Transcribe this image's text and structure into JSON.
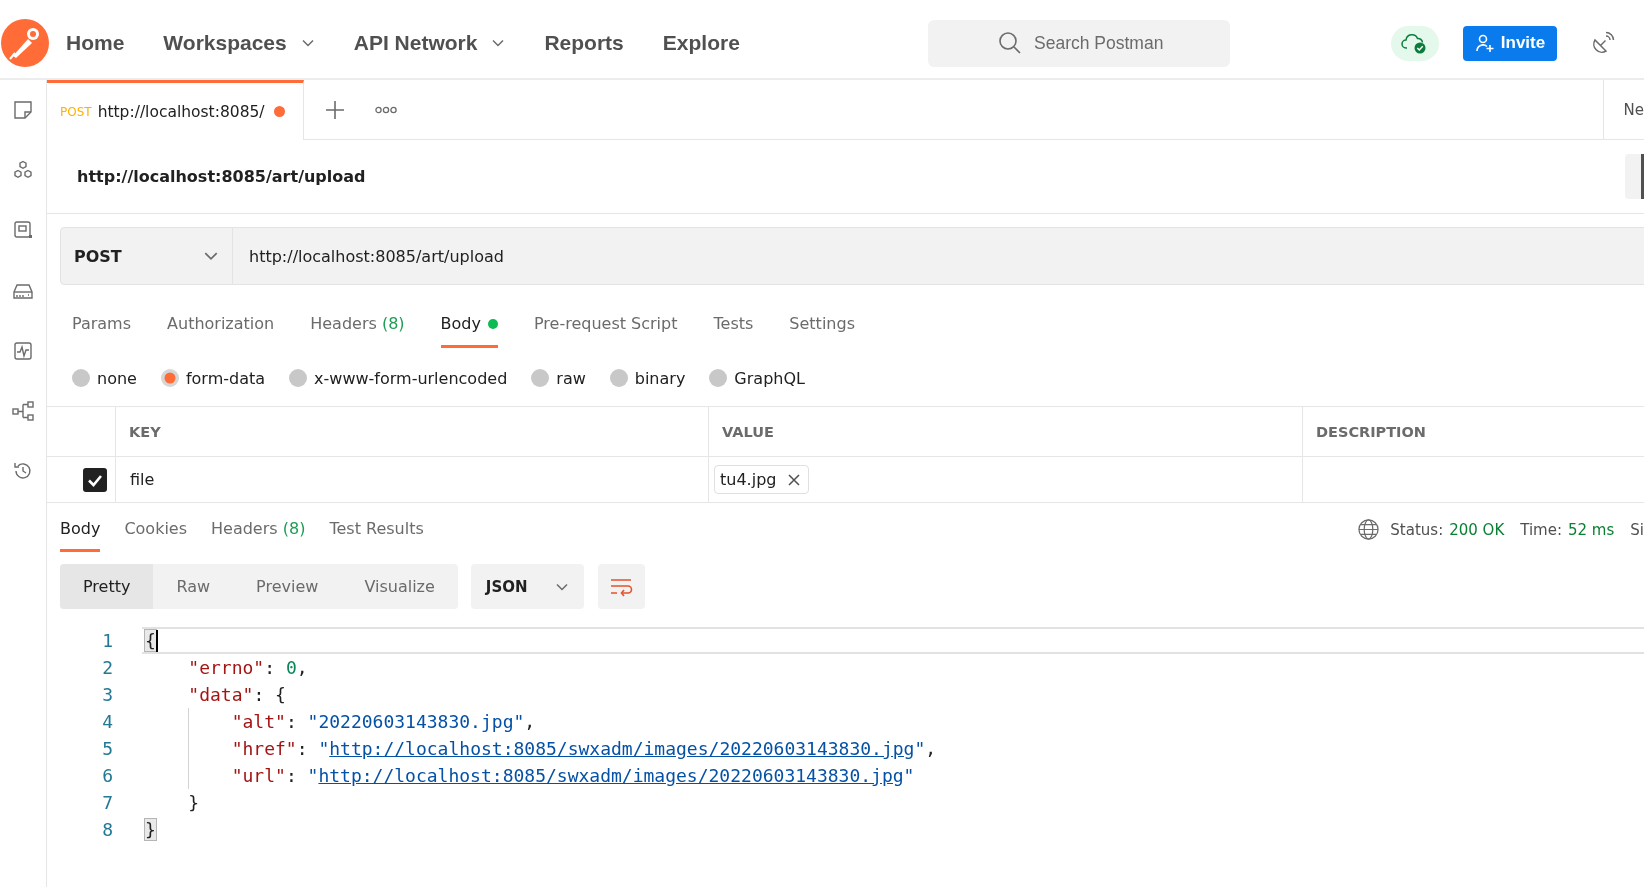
{
  "header": {
    "nav": [
      {
        "label": "Home",
        "dropdown": false
      },
      {
        "label": "Workspaces",
        "dropdown": true
      },
      {
        "label": "API Network",
        "dropdown": true
      },
      {
        "label": "Reports",
        "dropdown": false
      },
      {
        "label": "Explore",
        "dropdown": false
      }
    ],
    "search": {
      "placeholder": "Search Postman"
    },
    "invite_button": "Invite"
  },
  "tabs": {
    "items": [
      {
        "method": "POST",
        "label": "http://localhost:8085/",
        "selected": true,
        "unsaved": true
      }
    ],
    "environment": "Ne"
  },
  "request": {
    "title": "http://localhost:8085/art/upload",
    "method": "POST",
    "url": "http://localhost:8085/art/upload",
    "tabs": [
      {
        "label": "Params",
        "selected": false,
        "indicator": false
      },
      {
        "label": "Authorization",
        "selected": false,
        "indicator": false
      },
      {
        "label": "Headers",
        "count": "(8)",
        "selected": false,
        "indicator": false
      },
      {
        "label": "Body",
        "selected": true,
        "indicator": true
      },
      {
        "label": "Pre-request Script",
        "selected": false,
        "indicator": false
      },
      {
        "label": "Tests",
        "selected": false,
        "indicator": false
      },
      {
        "label": "Settings",
        "selected": false,
        "indicator": false
      }
    ],
    "body_types": [
      {
        "label": "none",
        "selected": false
      },
      {
        "label": "form-data",
        "selected": true
      },
      {
        "label": "x-www-form-urlencoded",
        "selected": false
      },
      {
        "label": "raw",
        "selected": false
      },
      {
        "label": "binary",
        "selected": false
      },
      {
        "label": "GraphQL",
        "selected": false
      }
    ],
    "table": {
      "columns": [
        "KEY",
        "VALUE",
        "DESCRIPTION"
      ],
      "rows": [
        {
          "checked": true,
          "key": "file",
          "file": "tu4.jpg"
        }
      ]
    }
  },
  "response": {
    "tabs": [
      {
        "label": "Body",
        "selected": true
      },
      {
        "label": "Cookies",
        "selected": false
      },
      {
        "label": "Headers",
        "count": "(8)",
        "selected": false
      },
      {
        "label": "Test Results",
        "selected": false
      }
    ],
    "status_label": "Status:",
    "status": "200 OK",
    "time_label": "Time:",
    "time": "52 ms",
    "size_label": "Si",
    "views": [
      {
        "label": "Pretty",
        "selected": true
      },
      {
        "label": "Raw",
        "selected": false
      },
      {
        "label": "Preview",
        "selected": false
      },
      {
        "label": "Visualize",
        "selected": false
      }
    ],
    "format": "JSON",
    "lines": [
      {
        "number": "1",
        "current": true,
        "tokens": [
          {
            "kind": "bracket",
            "text": "{"
          }
        ],
        "children": [
          {
            "number": "2",
            "current": false,
            "tokens": [
              {
                "kind": "key",
                "text": "\"errno\""
              },
              {
                "kind": "punct",
                "text": ": "
              },
              {
                "kind": "number",
                "text": "0"
              },
              {
                "kind": "punct",
                "text": ","
              }
            ]
          },
          {
            "number": "3",
            "current": false,
            "tokens": [
              {
                "kind": "key",
                "text": "\"data\""
              },
              {
                "kind": "punct",
                "text": ": {"
              }
            ],
            "children": [
              {
                "number": "4",
                "current": false,
                "tokens": [
                  {
                    "kind": "key",
                    "text": "\"alt\""
                  },
                  {
                    "kind": "punct",
                    "text": ": "
                  },
                  {
                    "kind": "string",
                    "text": "\"20220603143830.jpg\""
                  },
                  {
                    "kind": "punct",
                    "text": ","
                  }
                ]
              },
              {
                "number": "5",
                "current": false,
                "tokens": [
                  {
                    "kind": "key",
                    "text": "\"href\""
                  },
                  {
                    "kind": "punct",
                    "text": ": "
                  },
                  {
                    "kind": "string",
                    "text": "\""
                  },
                  {
                    "kind": "link",
                    "text": "http://localhost:8085/swxadm/images/20220603143830.jpg"
                  },
                  {
                    "kind": "string",
                    "text": "\""
                  },
                  {
                    "kind": "punct",
                    "text": ","
                  }
                ]
              },
              {
                "number": "6",
                "current": false,
                "tokens": [
                  {
                    "kind": "key",
                    "text": "\"url\""
                  },
                  {
                    "kind": "punct",
                    "text": ": "
                  },
                  {
                    "kind": "string",
                    "text": "\""
                  },
                  {
                    "kind": "link",
                    "text": "http://localhost:8085/swxadm/images/20220603143830.jpg"
                  },
                  {
                    "kind": "string",
                    "text": "\""
                  }
                ]
              }
            ]
          },
          {
            "number": "7",
            "current": false,
            "tokens": [
              {
                "kind": "punct",
                "text": "}"
              }
            ]
          }
        ]
      },
      {
        "number": "8",
        "current": false,
        "tokens": [
          {
            "kind": "bracket",
            "text": "}"
          }
        ]
      }
    ]
  }
}
